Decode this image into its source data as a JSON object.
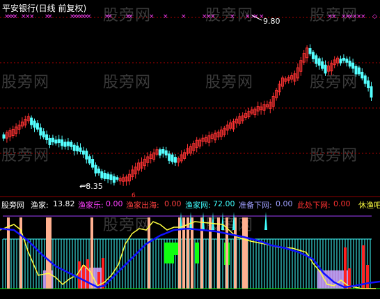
{
  "window": {
    "title": "平安银行(日线 前复权)"
  },
  "watermark": "股旁网",
  "colors": {
    "background": "#000000",
    "candle_up": "#ff3232",
    "candle_down": "#54ffff",
    "dotted_grid": "#b00000",
    "marker_x": "#ff40ff",
    "blue_line": "#1010ff",
    "yellow_line": "#ffff40",
    "cyan_hist": "#40ffff",
    "green_block": "#10ff10",
    "peach_bar": "#ffb090",
    "lilac_fill": "#d0a0ff"
  },
  "price_chart": {
    "high_label": "9.80",
    "low_label": "8.35"
  },
  "indicator": {
    "number_marker": "6",
    "name": "股旁网",
    "items": [
      {
        "label": "渔家:",
        "value": "13.82",
        "color": "#ffffff"
      },
      {
        "label": "渔家乐:",
        "value": "0.00",
        "color": "#ff40ff"
      },
      {
        "label": "渔家出海:",
        "value": "0.00",
        "color": "#ff4040"
      },
      {
        "label": "渔家网:",
        "value": "72.00",
        "color": "#40ffff"
      },
      {
        "label": "准备下网:",
        "value": "0.00",
        "color": "#a0a0ff"
      },
      {
        "label": "此处下网:",
        "value": "0.00",
        "color": "#ff3232"
      },
      {
        "label": "休渔吧",
        "value": "",
        "color": "#ffff40"
      }
    ]
  }
}
